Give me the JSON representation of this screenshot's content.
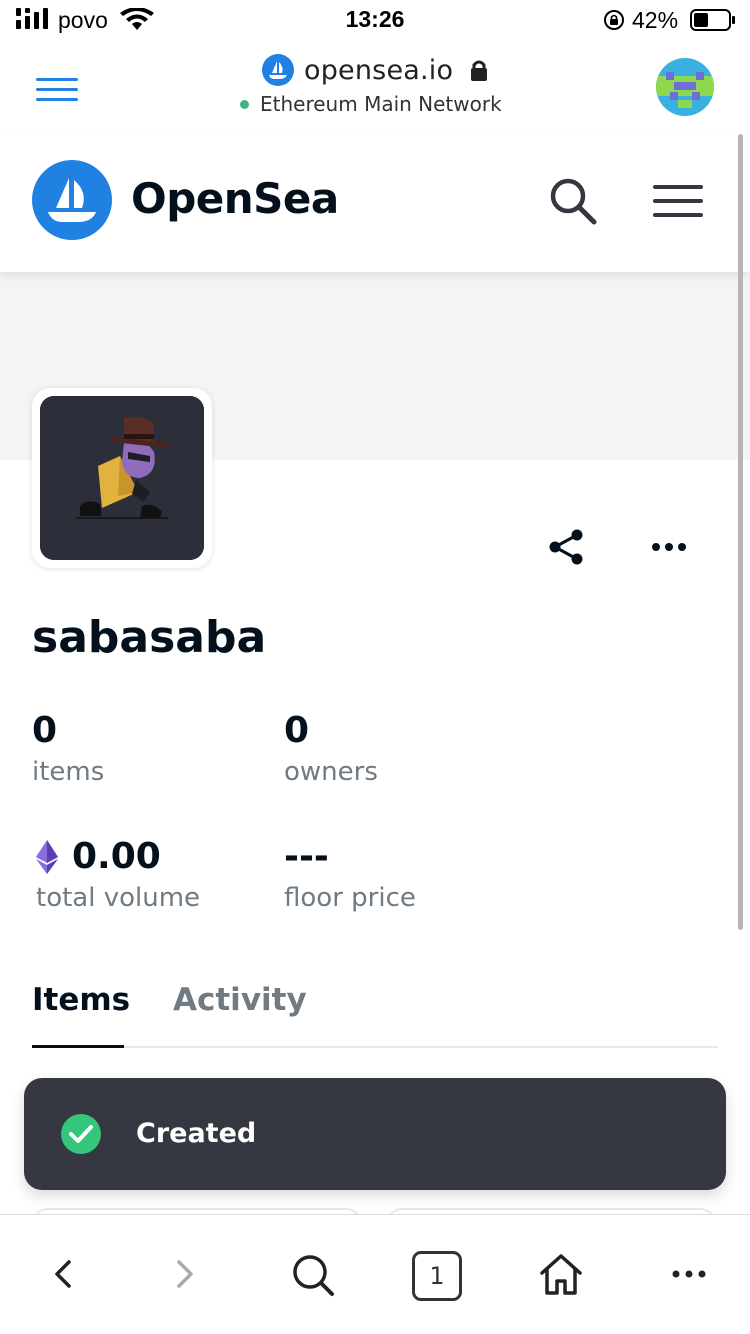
{
  "status_bar": {
    "carrier": "povo",
    "time": "13:26",
    "battery": "42%"
  },
  "browser": {
    "domain": "opensea.io",
    "network": "Ethereum Main Network"
  },
  "site": {
    "brand": "OpenSea"
  },
  "collection": {
    "name": "sabasaba",
    "stats": {
      "items_value": "0",
      "items_label": "items",
      "owners_value": "0",
      "owners_label": "owners",
      "volume_value": "0.00",
      "volume_label": "total volume",
      "floor_value": "---",
      "floor_label": "floor price"
    }
  },
  "tabs": [
    {
      "label": "Items",
      "active": true
    },
    {
      "label": "Activity",
      "active": false
    }
  ],
  "toast": {
    "message": "Created"
  },
  "toolbar": {
    "tab_count": "1"
  },
  "colors": {
    "brand_blue": "#2081e2",
    "toast_bg": "#353840",
    "success_green": "#34c77b",
    "network_dot": "#3fb580"
  },
  "icons": [
    "signal-icon",
    "wifi-icon",
    "orientation-lock-icon",
    "battery-icon",
    "hamburger-menu-icon",
    "opensea-logo-icon",
    "padlock-icon",
    "wallet-avatar-icon",
    "search-icon",
    "share-icon",
    "more-icon",
    "ethereum-icon",
    "check-circle-icon",
    "back-icon",
    "forward-icon",
    "home-icon"
  ]
}
